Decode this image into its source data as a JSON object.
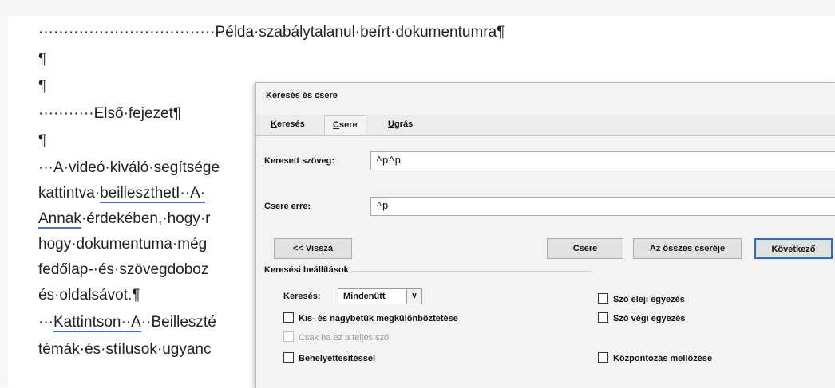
{
  "document": {
    "heading_prefix": "···································",
    "heading": "Példa·szabálytalanul·beírt·dokumentumra¶",
    "pilcrow1": "¶",
    "pilcrow2": "¶",
    "chapter_prefix": "···········",
    "chapter": "Első·fejezet¶",
    "pilcrow3": "¶",
    "line1": "···A·videó·kiváló·segítsége",
    "line2a": "kattintva·",
    "line2b": "beilleszthetI··A·",
    "line3a": "Annak",
    "line3b": "·érdekében,·hogy·r",
    "line4": "hogy·dokumentuma·még",
    "line5": "fedőlap-·és·szövegdoboz",
    "line6": "és·oldalsávot.¶",
    "line7a": "···",
    "line7b": "Kattintson··A",
    "line7c": "··Beilleszté",
    "line8": "témák·és·stílusok·ugyanc"
  },
  "dialog": {
    "title": "Keresés és csere",
    "tabs": [
      {
        "pre": "",
        "key": "K",
        "post": "eresés"
      },
      {
        "pre": "",
        "key": "C",
        "post": "sere"
      },
      {
        "pre": "",
        "key": "U",
        "post": "grás"
      }
    ],
    "find_label": "Keresett szöveg:",
    "find_value": "^p^p",
    "replace_label": "Csere erre:",
    "replace_value": "^p",
    "btn_back": "<< Vissza",
    "btn_replace": "Csere",
    "btn_replace_all": "Az összes cseréje",
    "btn_next": "Következő",
    "options_title": "Keresési beállítások",
    "search_label": "Keresés:",
    "search_value": "Mindenütt",
    "opt_match_case": "Kis- és nagybetűk megkülönböztetése",
    "opt_whole_word": "Csak ha ez a teljes szó",
    "opt_wildcards": "Behelyettesítéssel",
    "opt_prefix": "Szó eleji egyezés",
    "opt_suffix": "Szó végi egyezés",
    "opt_ignore_punct": "Központozás mellőzése"
  }
}
